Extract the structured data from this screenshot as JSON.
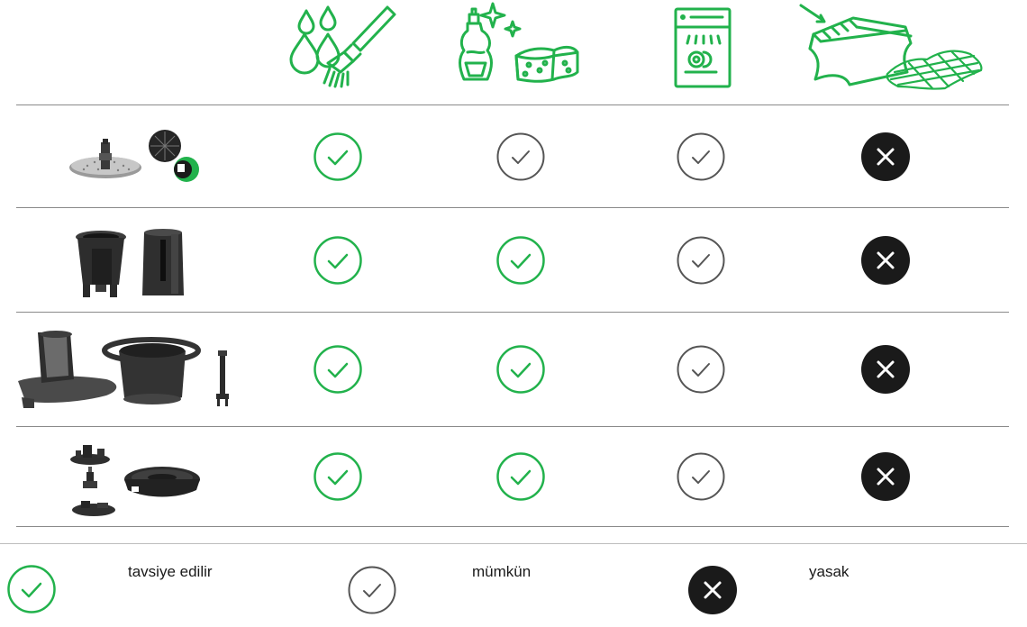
{
  "colors": {
    "recommended": "#22b24c",
    "possible": "#555555",
    "forbidden": "#1a1a1a",
    "divider": "#8a8a8a"
  },
  "header": {
    "columns": [
      {
        "icon": "water-and-brush-icon"
      },
      {
        "icon": "detergent-and-sponge-icon"
      },
      {
        "icon": "dishwasher-icon"
      },
      {
        "icon": "abrasive-sponge-and-scourer-icon"
      }
    ]
  },
  "rows": [
    {
      "part": "slicing-disc-icon",
      "marks": [
        "recommended",
        "possible",
        "possible",
        "forbidden"
      ]
    },
    {
      "part": "spiralizer-inserts-icon",
      "marks": [
        "recommended",
        "recommended",
        "possible",
        "forbidden"
      ]
    },
    {
      "part": "lid-bowl-and-shaft-icon",
      "marks": [
        "recommended",
        "recommended",
        "possible",
        "forbidden"
      ]
    },
    {
      "part": "blade-parts-and-lid-ring-icon",
      "marks": [
        "recommended",
        "recommended",
        "possible",
        "forbidden"
      ]
    }
  ],
  "legend": {
    "recommended_label": "tavsiye edilir",
    "possible_label": "mümkün",
    "forbidden_label": "yasak"
  }
}
